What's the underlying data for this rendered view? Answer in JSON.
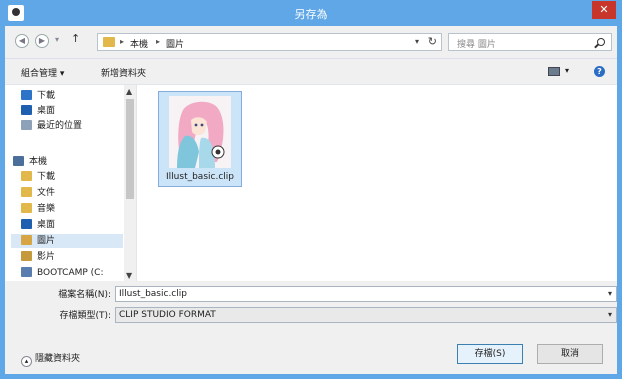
{
  "window": {
    "title": "另存為",
    "close_label": "✕"
  },
  "nav": {
    "back_icon": "arrow-left-icon",
    "forward_icon": "arrow-right-icon",
    "up_label": "↑",
    "breadcrumb": [
      "本機",
      "圖片"
    ],
    "search_placeholder": "搜尋 圖片"
  },
  "toolbar": {
    "organize_label": "組合管理 ▾",
    "new_folder_label": "新增資料夾"
  },
  "sidebar": {
    "items": [
      {
        "label": "下載",
        "icon": "downloads-icon"
      },
      {
        "label": "桌面",
        "icon": "desktop-icon"
      },
      {
        "label": "最近的位置",
        "icon": "recent-places-icon"
      },
      {
        "label": "本機",
        "icon": "this-pc-icon"
      },
      {
        "label": "下載",
        "icon": "downloads-icon"
      },
      {
        "label": "文件",
        "icon": "documents-icon"
      },
      {
        "label": "音樂",
        "icon": "music-icon"
      },
      {
        "label": "桌面",
        "icon": "desktop-icon"
      },
      {
        "label": "圖片",
        "icon": "pictures-icon"
      },
      {
        "label": "影片",
        "icon": "videos-icon"
      },
      {
        "label": "BOOTCAMP (C:",
        "icon": "drive-icon"
      }
    ],
    "selected_index": 8
  },
  "files": [
    {
      "name": "Illust_basic.clip",
      "selected": true
    }
  ],
  "form": {
    "filename_label": "檔案名稱(N):",
    "filename_value": "Illust_basic.clip",
    "filetype_label": "存檔類型(T):",
    "filetype_value": "CLIP STUDIO FORMAT",
    "hide_folders_label": "隱藏資料夾",
    "save_label": "存檔(S)",
    "cancel_label": "取消"
  },
  "colors": {
    "title_bar": "#5fa7e6",
    "close_button": "#c7352b",
    "selection": "#cce4f7"
  }
}
